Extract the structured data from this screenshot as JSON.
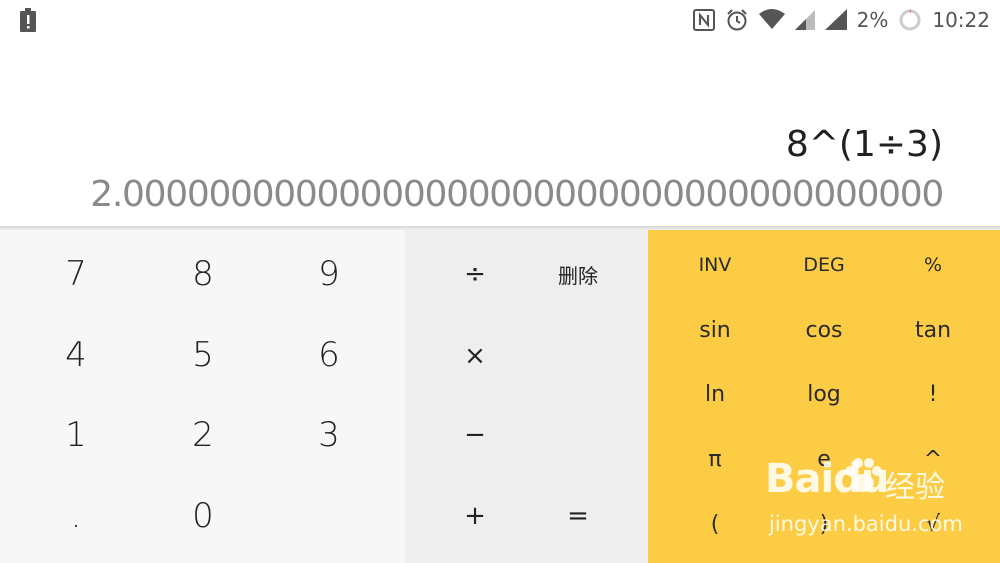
{
  "status_bar": {
    "battery_percent": "2%",
    "time": "10:22",
    "icons": [
      "battery-alert-icon",
      "nfc-icon",
      "alarm-icon",
      "wifi-icon",
      "signal-icon",
      "signal-icon",
      "battery-ring-icon"
    ]
  },
  "display": {
    "formula": "8^(1÷3)",
    "result": "2.00000000000000000000000000000000000000"
  },
  "number_pad": {
    "keys": [
      "7",
      "8",
      "9",
      "4",
      "5",
      "6",
      "1",
      "2",
      "3",
      ".",
      "0"
    ]
  },
  "operator_pad": {
    "divide": "÷",
    "delete": "删除",
    "multiply": "×",
    "minus": "−",
    "plus": "+",
    "equals": "="
  },
  "advanced_pad": {
    "keys": [
      "INV",
      "DEG",
      "%",
      "sin",
      "cos",
      "tan",
      "ln",
      "log",
      "!",
      "π",
      "e",
      "^",
      "(",
      ")",
      "√"
    ]
  },
  "watermark": {
    "logo": "Baidu",
    "cn": "经验",
    "url": "jingyan.baidu.com"
  },
  "colors": {
    "advanced_pad_bg": "#fdcc45",
    "operator_pad_bg": "#eeeeee",
    "number_pad_bg": "#f7f7f7",
    "result_text": "#8a8a8a"
  }
}
